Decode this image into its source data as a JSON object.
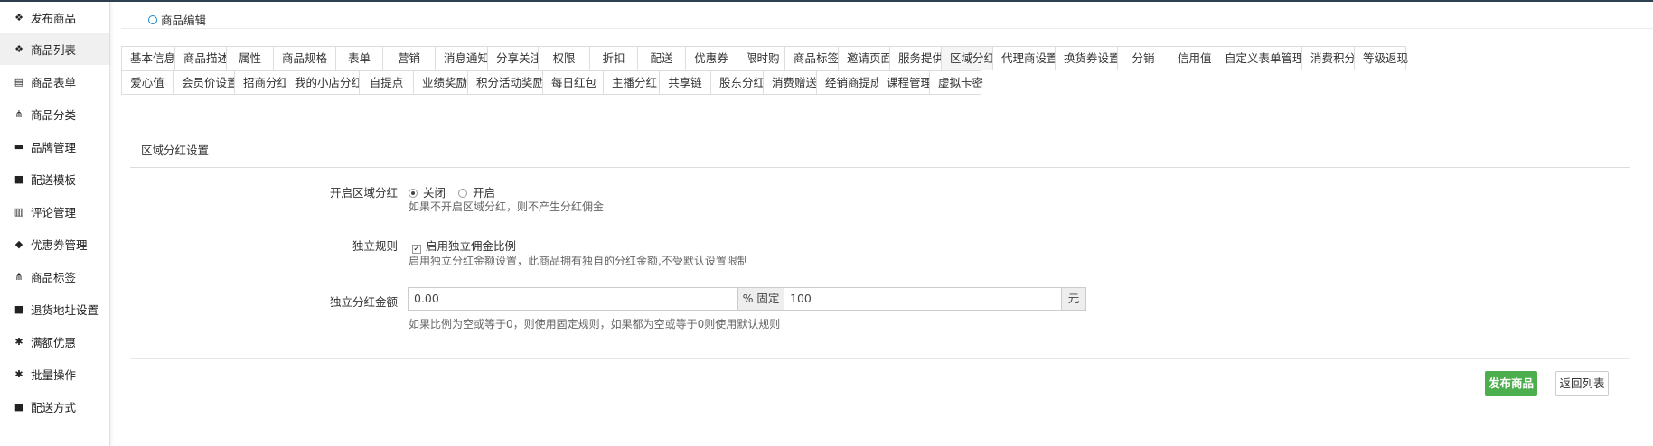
{
  "sidebar": {
    "items": [
      {
        "label": "发布商品",
        "icon": "cubes-icon"
      },
      {
        "label": "商品列表",
        "icon": "cubes-icon"
      },
      {
        "label": "商品表单",
        "icon": "file-icon"
      },
      {
        "label": "商品分类",
        "icon": "sitemap-icon"
      },
      {
        "label": "品牌管理",
        "icon": "briefcase-icon"
      },
      {
        "label": "配送模板",
        "icon": "truck-icon"
      },
      {
        "label": "评论管理",
        "icon": "columns-icon"
      },
      {
        "label": "优惠券管理",
        "icon": "tags-icon"
      },
      {
        "label": "商品标签",
        "icon": "sitemap-icon"
      },
      {
        "label": "退货地址设置",
        "icon": "truck-icon"
      },
      {
        "label": "满额优惠",
        "icon": "gift-icon"
      },
      {
        "label": "批量操作",
        "icon": "gift-icon"
      },
      {
        "label": "配送方式",
        "icon": "truck-icon"
      }
    ]
  },
  "breadcrumb": {
    "label": "商品编辑"
  },
  "tabs": {
    "row1": [
      "基本信息",
      "商品描述",
      "属性",
      "商品规格",
      "表单",
      "营销",
      "消息通知",
      "分享关注",
      "权限",
      "折扣",
      "配送",
      "优惠券",
      "限时购",
      "商品标签",
      "邀请页面",
      "服务提供",
      "区域分红",
      "代理商设置",
      "换货券设置",
      "分销",
      "信用值",
      "自定义表单管理",
      "消费积分",
      "等级返现"
    ],
    "row2": [
      "爱心值",
      "会员价设置",
      "招商分红",
      "我的小店分红",
      "自提点",
      "业绩奖励",
      "积分活动奖励",
      "每日红包",
      "主播分红",
      "共享链",
      "股东分红",
      "消费赠送",
      "经销商提成",
      "课程管理",
      "虚拟卡密"
    ],
    "active": "区域分红"
  },
  "section": {
    "title": "区域分红设置",
    "enable": {
      "label": "开启区域分红",
      "options": [
        "关闭",
        "开启"
      ],
      "selected": "关闭",
      "help": "如果不开启区域分红，则不产生分红佣金"
    },
    "rule": {
      "label": "独立规则",
      "checkbox_label": "启用独立佣金比例",
      "checked": true,
      "help": "启用独立分红金额设置，此商品拥有独自的分红金额,不受默认设置限制"
    },
    "amount": {
      "label": "独立分红金额",
      "ratio_value": "0.00",
      "addon_mid": "% 固定",
      "fixed_value": "100",
      "addon_end": "元",
      "help": "如果比例为空或等于0，则使用固定规则，如果都为空或等于0则使用默认规则"
    }
  },
  "actions": {
    "publish": "发布商品",
    "back": "返回列表"
  },
  "colors": {
    "primary": "#4cae4c",
    "accent": "#1e88c7"
  }
}
